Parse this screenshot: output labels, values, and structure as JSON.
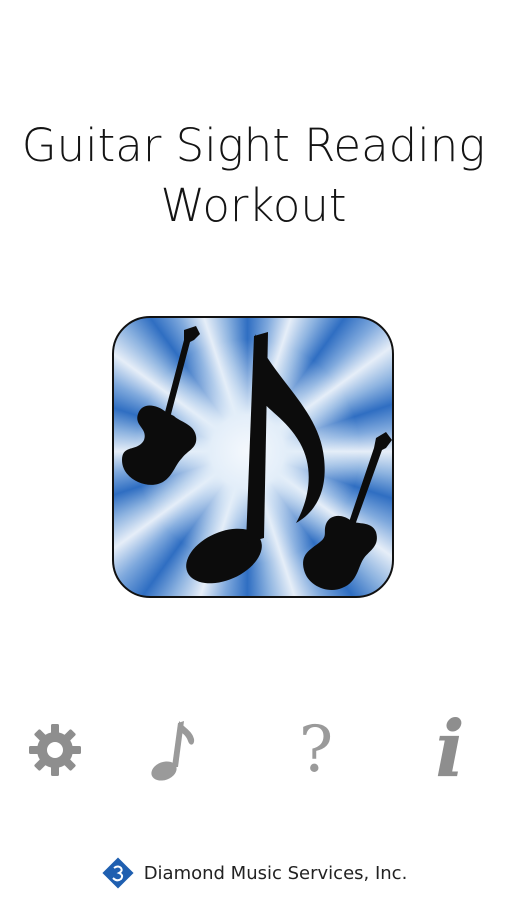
{
  "title": {
    "line1": "Guitar Sight Reading",
    "line2": "Workout"
  },
  "app_icon": {
    "name": "guitar-note-icon",
    "colors": {
      "blue": "#2f6ec2",
      "light": "#e6eef8",
      "silhouette": "#0c0c0c"
    }
  },
  "toolbar": {
    "settings_icon": "gear-icon",
    "notes_icon": "music-note-icon",
    "help_label": "?",
    "info_label": "i",
    "icon_color": "#9a9a9a"
  },
  "footer": {
    "logo_icon": "diamond-logo-icon",
    "company": "Diamond Music Services, Inc.",
    "logo_color": "#1f5fb0"
  }
}
